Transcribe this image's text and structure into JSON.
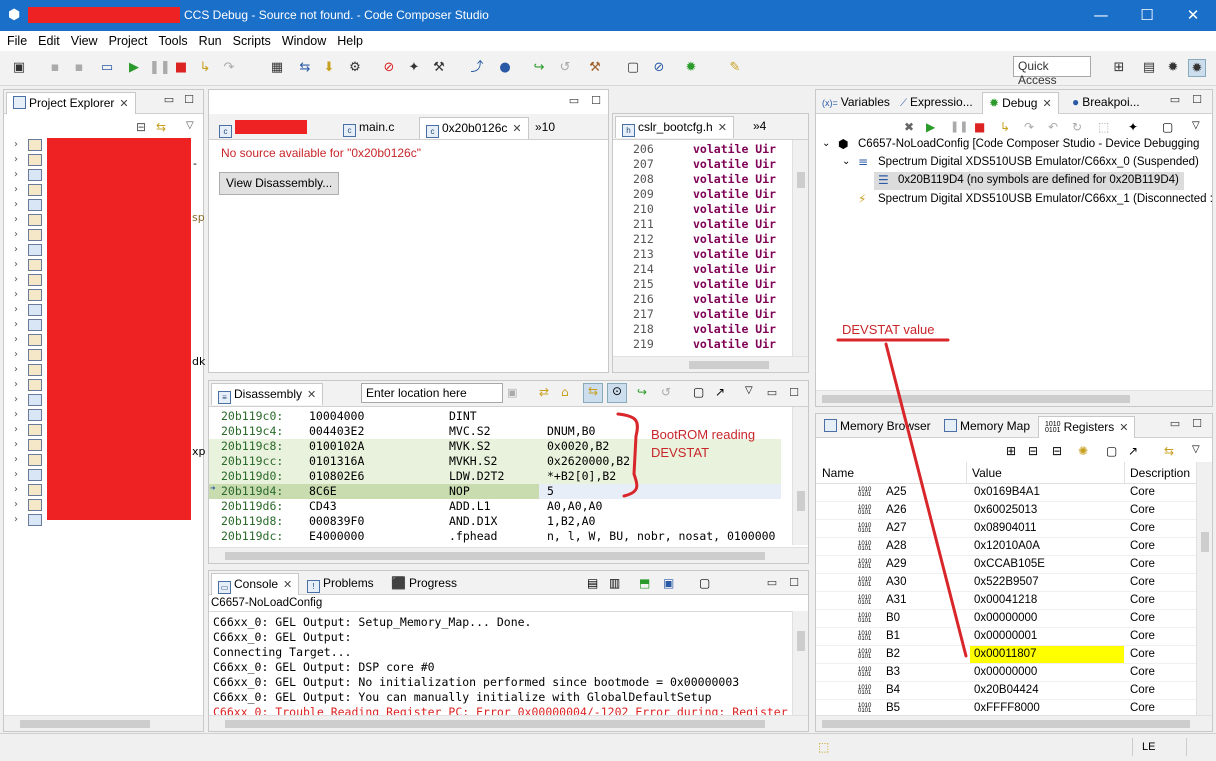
{
  "window": {
    "title": "CCS Debug - Source not found. - Code Composer Studio",
    "minimize": "—",
    "maximize": "☐",
    "close": "✕"
  },
  "menu": [
    "File",
    "Edit",
    "View",
    "Project",
    "Tools",
    "Run",
    "Scripts",
    "Window",
    "Help"
  ],
  "toolbar": {
    "quick_access": "Quick Access"
  },
  "project_explorer": {
    "tab": "Project Explorer",
    "side_fragments": [
      "-",
      "sp",
      "dk",
      "xp"
    ]
  },
  "editor": {
    "tabs": [
      "main.c",
      "0x20b0126c",
      "»10"
    ],
    "no_source": "No source available for \"0x20b0126c\"",
    "view_disassembly": "View Disassembly..."
  },
  "header_editor": {
    "tabs": [
      "cslr_bootcfg.h",
      "»4"
    ],
    "lines": [
      {
        "n": "206",
        "code": "volatile Uir"
      },
      {
        "n": "207",
        "code": "volatile Uir"
      },
      {
        "n": "208",
        "code": "volatile Uir"
      },
      {
        "n": "209",
        "code": "volatile Uir"
      },
      {
        "n": "210",
        "code": "volatile Uir"
      },
      {
        "n": "211",
        "code": "volatile Uir"
      },
      {
        "n": "212",
        "code": "volatile Uir"
      },
      {
        "n": "213",
        "code": "volatile Uir"
      },
      {
        "n": "214",
        "code": "volatile Uir"
      },
      {
        "n": "215",
        "code": "volatile Uir"
      },
      {
        "n": "216",
        "code": "volatile Uir"
      },
      {
        "n": "217",
        "code": "volatile Uir"
      },
      {
        "n": "218",
        "code": "volatile Uir"
      },
      {
        "n": "219",
        "code": "volatile Uir"
      }
    ]
  },
  "disassembly": {
    "tab": "Disassembly",
    "location_placeholder": "Enter location here",
    "rows": [
      {
        "addr": "20b119c0:",
        "hex": "10004000",
        "op": "DINT",
        "args": ""
      },
      {
        "addr": "20b119c4:",
        "hex": "004403E2",
        "op": "MVC.S2",
        "args": "DNUM,B0"
      },
      {
        "addr": "20b119c8:",
        "hex": "0100102A",
        "op": "MVK.S2",
        "args": "0x0020,B2"
      },
      {
        "addr": "20b119cc:",
        "hex": "0101316A",
        "op": "MVKH.S2",
        "args": "0x2620000,B2"
      },
      {
        "addr": "20b119d0:",
        "hex": "010802E6",
        "op": "LDW.D2T2",
        "args": "*+B2[0],B2"
      },
      {
        "addr": "20b119d4:",
        "hex": "8C6E",
        "op": "NOP",
        "args": "5"
      },
      {
        "addr": "20b119d6:",
        "hex": "CD43",
        "op": "ADD.L1",
        "args": "A0,A0,A0"
      },
      {
        "addr": "20b119d8:",
        "hex": "000839F0",
        "op": "AND.D1X",
        "args": "1,B2,A0"
      },
      {
        "addr": "20b119dc:",
        "hex": "E4000000",
        "op": ".fphead",
        "args": "n, l, W, BU, nobr, nosat, 0100000"
      }
    ]
  },
  "annotations": {
    "bootrom": [
      "BootROM reading",
      "DEVSTAT"
    ],
    "devstat": "DEVSTAT value"
  },
  "console": {
    "tabs": [
      "Console",
      "Problems",
      "Progress"
    ],
    "header": "C6657-NoLoadConfig",
    "lines": [
      "C66xx_0: GEL Output: Setup_Memory_Map... Done.",
      "C66xx_0: GEL Output:",
      "Connecting Target...",
      "C66xx_0: GEL Output: DSP core #0",
      "C66xx_0: GEL Output: No initialization performed since bootmode = 0x00000003",
      "C66xx_0: GEL Output: You can manually initialize with GlobalDefaultSetup"
    ],
    "error_line": "C66xx_0: Trouble Reading Register PC: Error 0x00000004/-1202 Error during: Register"
  },
  "debug_view": {
    "tabs": [
      "Variables",
      "Expressio...",
      "Debug",
      "Breakpoi..."
    ],
    "tree": [
      "C6657-NoLoadConfig [Code Composer Studio - Device Debugging",
      "Spectrum Digital XDS510USB Emulator/C66xx_0 (Suspended)",
      "0x20B119D4  (no symbols are defined for 0x20B119D4)",
      "Spectrum Digital XDS510USB Emulator/C66xx_1 (Disconnected :"
    ]
  },
  "registers": {
    "tabs": [
      "Memory Browser",
      "Memory Map",
      "Registers"
    ],
    "columns": [
      "Name",
      "Value",
      "Description"
    ],
    "rows": [
      {
        "name": "A25",
        "value": "0x0169B4A1",
        "desc": "Core"
      },
      {
        "name": "A26",
        "value": "0x60025013",
        "desc": "Core"
      },
      {
        "name": "A27",
        "value": "0x08904011",
        "desc": "Core"
      },
      {
        "name": "A28",
        "value": "0x12010A0A",
        "desc": "Core"
      },
      {
        "name": "A29",
        "value": "0xCCAB105E",
        "desc": "Core"
      },
      {
        "name": "A30",
        "value": "0x522B9507",
        "desc": "Core"
      },
      {
        "name": "A31",
        "value": "0x00041218",
        "desc": "Core"
      },
      {
        "name": "B0",
        "value": "0x00000000",
        "desc": "Core"
      },
      {
        "name": "B1",
        "value": "0x00000001",
        "desc": "Core"
      },
      {
        "name": "B2",
        "value": "0x00011807",
        "desc": "Core"
      },
      {
        "name": "B3",
        "value": "0x00000000",
        "desc": "Core"
      },
      {
        "name": "B4",
        "value": "0x20B04424",
        "desc": "Core"
      },
      {
        "name": "B5",
        "value": "0xFFFF8000",
        "desc": "Core"
      }
    ],
    "highlight_color": "#ffff00"
  },
  "status": {
    "mode": "LE"
  },
  "colors": {
    "titlebar": "#1a6fc9",
    "annotation": "#c8262a",
    "redaction": "#ee2222",
    "keyword": "#7f0055"
  }
}
